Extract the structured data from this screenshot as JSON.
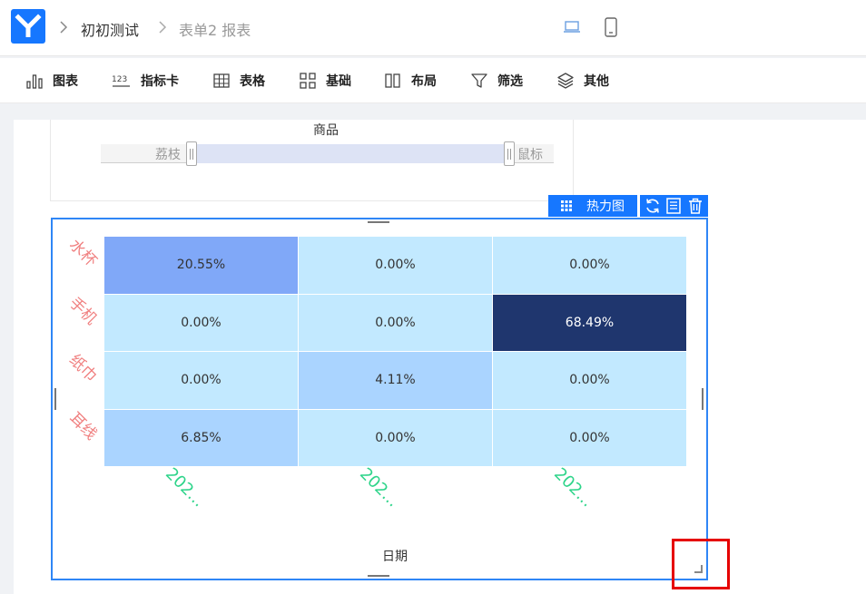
{
  "header": {
    "breadcrumb": [
      "初初测试",
      "表单2 报表"
    ]
  },
  "toolbar": {
    "items": [
      {
        "label": "图表",
        "icon": "bar-chart-icon"
      },
      {
        "label": "指标卡",
        "icon": "number-card-icon"
      },
      {
        "label": "表格",
        "icon": "table-icon"
      },
      {
        "label": "基础",
        "icon": "basic-grid-icon"
      },
      {
        "label": "布局",
        "icon": "layout-icon"
      },
      {
        "label": "筛选",
        "icon": "filter-icon"
      },
      {
        "label": "其他",
        "icon": "layers-icon"
      }
    ]
  },
  "slider": {
    "title": "商品",
    "start_label": "荔枝",
    "end_label": "鼠标"
  },
  "widget": {
    "type_label": "热力图",
    "actions": [
      "refresh-icon",
      "data-icon",
      "delete-icon"
    ]
  },
  "chart_data": {
    "type": "heatmap",
    "y_categories": [
      "水杯",
      "手机",
      "纸巾",
      "耳线"
    ],
    "x_tick_labels": [
      "202...",
      "202...",
      "202..."
    ],
    "xlabel": "日期",
    "values": [
      [
        "20.55%",
        "0.00%",
        "0.00%"
      ],
      [
        "0.00%",
        "0.00%",
        "68.49%"
      ],
      [
        "0.00%",
        "4.11%",
        "0.00%"
      ],
      [
        "6.85%",
        "0.00%",
        "0.00%"
      ]
    ],
    "numeric": [
      [
        20.55,
        0.0,
        0.0
      ],
      [
        0.0,
        0.0,
        68.49
      ],
      [
        0.0,
        4.11,
        0.0
      ],
      [
        6.85,
        0.0,
        0.0
      ]
    ],
    "color_scale": [
      "#c2e9ff",
      "#aad4ff",
      "#80a8f8",
      "#1f366e"
    ],
    "grid": false
  }
}
